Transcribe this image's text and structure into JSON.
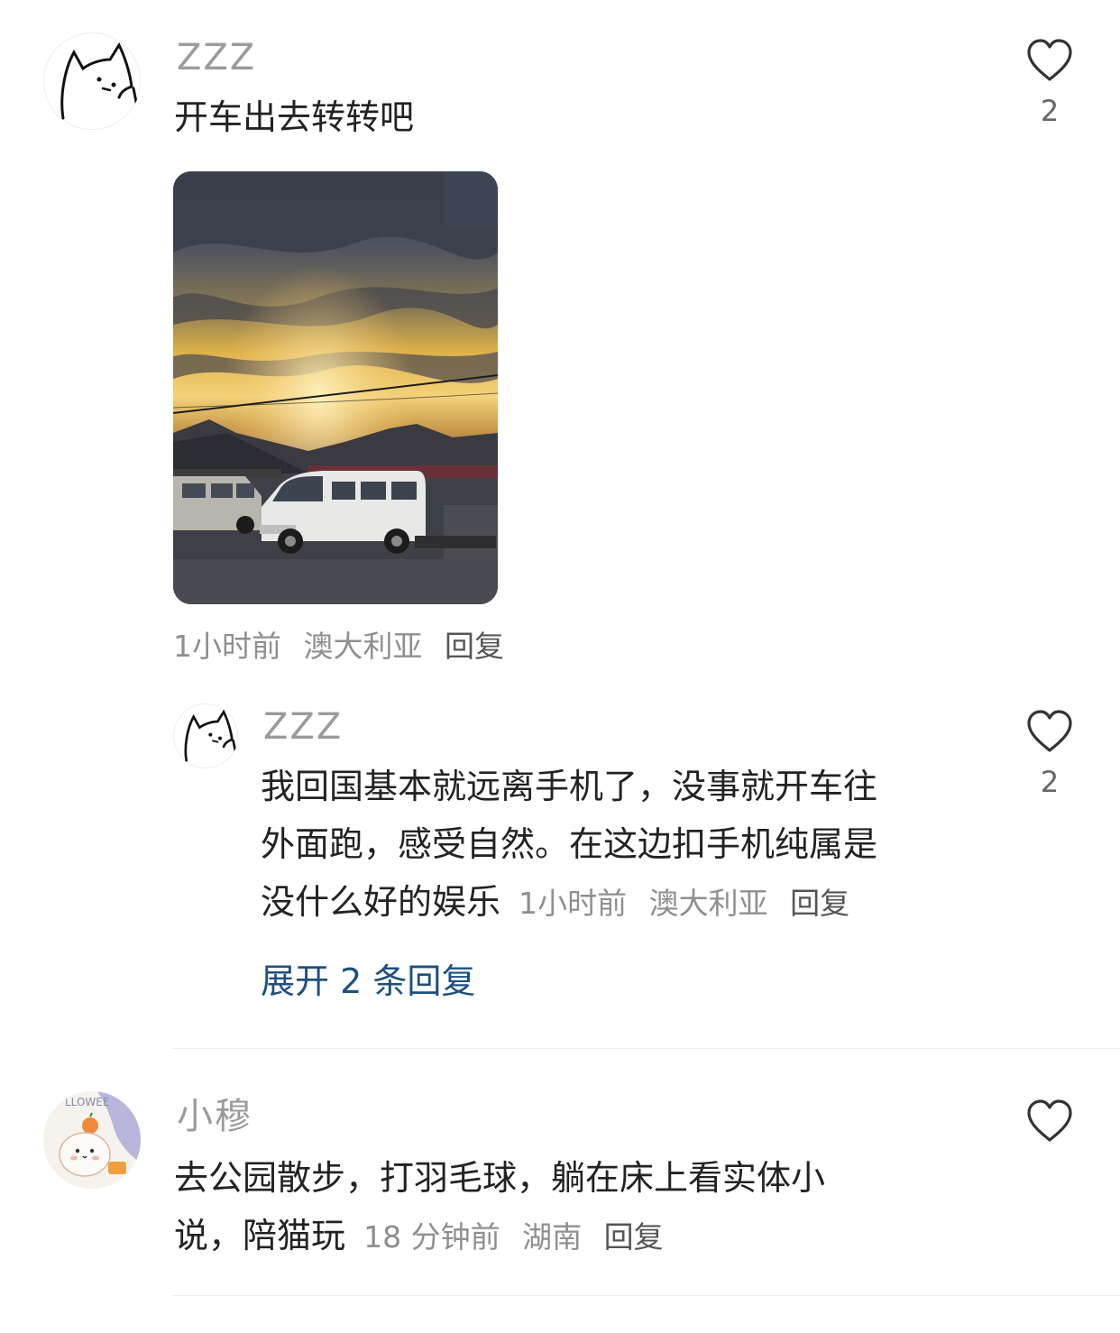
{
  "comments": [
    {
      "username": "ZZZ",
      "text": "开车出去转转吧",
      "time": "1小时前",
      "location": "澳大利亚",
      "reply_label": "回复",
      "likes": "2",
      "avatar_icon": "cat-doodle-avatar",
      "image": "sunset-vans-photo"
    },
    {
      "username": "ZZZ",
      "text_lines": [
        "我回国基本就远离手机了，没事就开车往",
        "外面跑，感受自然。在这边扣手机纯属是",
        "没什么好的娱乐"
      ],
      "time": "1小时前",
      "location": "澳大利亚",
      "reply_label": "回复",
      "likes": "2",
      "avatar_icon": "cat-doodle-avatar",
      "expand_label": "展开 2 条回复"
    },
    {
      "username": "小穆",
      "text_lines": [
        "去公园散步，打羽毛球，躺在床上看实体小",
        "说，陪猫玩"
      ],
      "time": "18 分钟前",
      "location": "湖南",
      "reply_label": "回复",
      "avatar_icon": "hamster-sticker-avatar"
    }
  ],
  "colors": {
    "username": "#9b9b9b",
    "text": "#222222",
    "meta": "#8f8f8f",
    "link": "#1f4f7f"
  }
}
